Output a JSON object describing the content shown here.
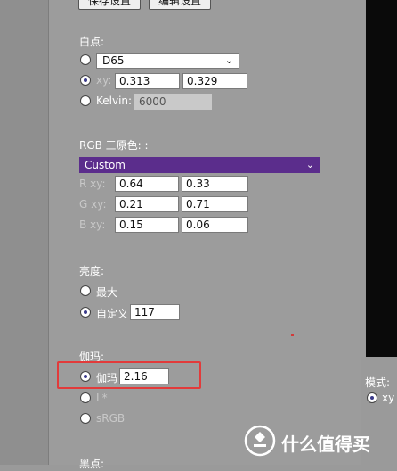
{
  "toolbar": {
    "save_label": "保存设置",
    "edit_label": "编辑设置"
  },
  "white_point": {
    "heading": "白点:",
    "preset_value": "D65",
    "xy_label": "xy:",
    "x_value": "0.313",
    "y_value": "0.329",
    "kelvin_label": "Kelvin:",
    "kelvin_value": "6000"
  },
  "primaries": {
    "heading": "RGB 三原色: :",
    "select_value": "Custom",
    "rows": [
      {
        "label": "R xy:",
        "x": "0.64",
        "y": "0.33"
      },
      {
        "label": "G xy:",
        "x": "0.21",
        "y": "0.71"
      },
      {
        "label": "B xy:",
        "x": "0.15",
        "y": "0.06"
      }
    ]
  },
  "brightness": {
    "heading": "亮度:",
    "max_label": "最大",
    "custom_label": "自定义",
    "custom_value": "117"
  },
  "gamma": {
    "heading": "伽玛:",
    "gamma_label": "伽玛",
    "gamma_value": "2.16",
    "lstar_label": "L*",
    "srgb_label": "sRGB"
  },
  "black_point": {
    "heading": "黑点:"
  },
  "right_panel": {
    "mode_label": "模式:",
    "xy_label": "xy"
  },
  "watermark": {
    "text": "什么值得买"
  },
  "colors": {
    "accent_purple": "#5b2d8c",
    "highlight_red": "#e23a3a"
  }
}
